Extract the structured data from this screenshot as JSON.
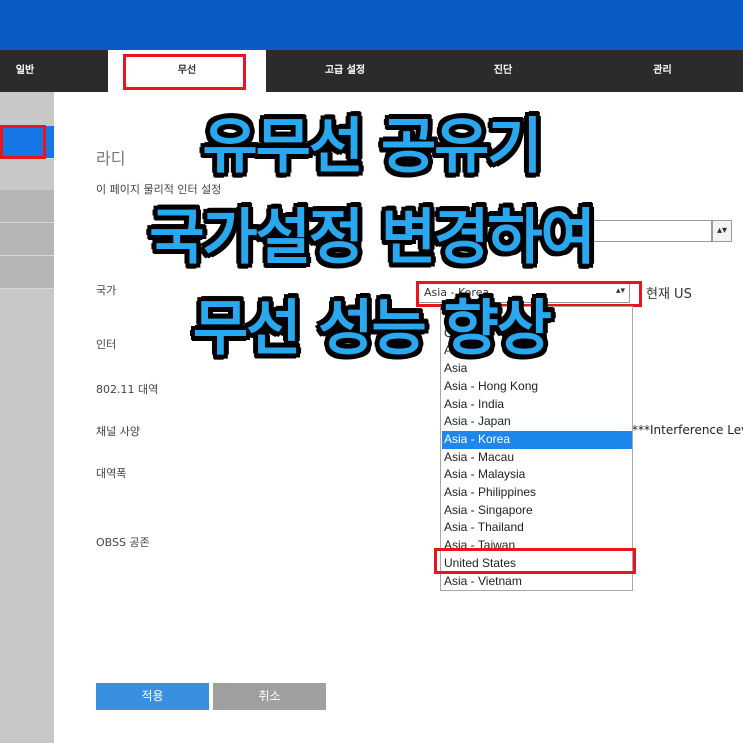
{
  "tabs": [
    {
      "label": "일반"
    },
    {
      "label": "무선"
    },
    {
      "label": "고급 설정"
    },
    {
      "label": "진단"
    },
    {
      "label": "관리"
    }
  ],
  "content": {
    "title": "라디",
    "description": "이 페이지    물리적      인터           설정",
    "country_label": "국가",
    "country_select_value": "Asia - Korea",
    "current_label": "현재 US",
    "interface_label": "인터",
    "band_label": "802.11 대역",
    "channel_label": "채널 사양",
    "interference_text": "***Interference Lev",
    "bandwidth_label": "대역폭",
    "obss_label": "OBSS 공존"
  },
  "dropdown": {
    "options": [
      "Aus",
      "Can",
      "Asia",
      "Asia",
      "Asia - Hong Kong",
      "Asia - India",
      "Asia - Japan",
      "Asia - Korea",
      "Asia - Macau",
      "Asia - Malaysia",
      "Asia - Philippines",
      "Asia - Singapore",
      "Asia - Thailand",
      "Asia - Taiwan",
      "United States",
      "Asia - Vietnam"
    ],
    "selected": "Asia - Korea",
    "highlighted": "United States"
  },
  "buttons": {
    "apply": "적용",
    "cancel": "취소"
  },
  "overlay": {
    "line1": "유무선 공유기",
    "line2": "국가설정 변경하여",
    "line3": "무선 성능 향상"
  },
  "colors": {
    "topbar": "#0a5bc4",
    "tabbar": "#2b2b2b",
    "highlight_red": "#e8141e",
    "selected_blue": "#1e87ee",
    "apply_button": "#3b8fe0",
    "cancel_button": "#a0a0a0",
    "overlay_text": "#29a8f0"
  }
}
